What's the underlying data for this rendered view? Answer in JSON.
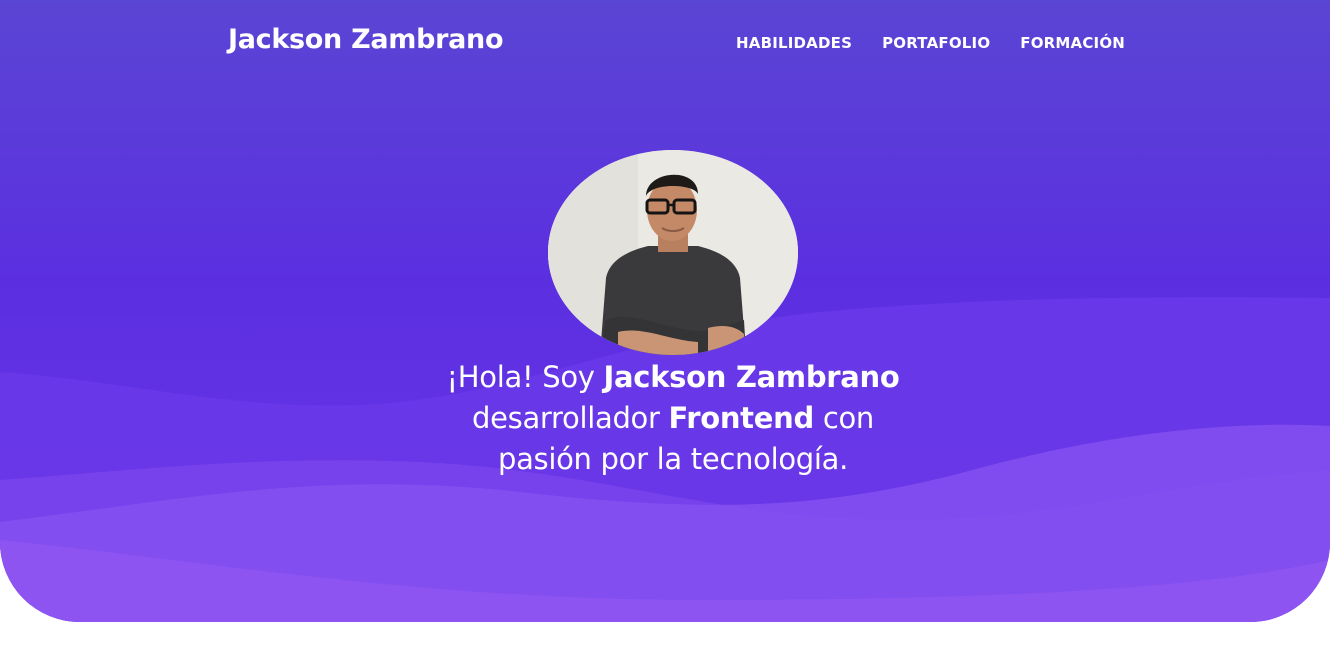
{
  "header": {
    "brand": "Jackson Zambrano",
    "nav": [
      {
        "label": "HABILIDADES"
      },
      {
        "label": "PORTAFOLIO"
      },
      {
        "label": "FORMACIÓN"
      }
    ]
  },
  "hero": {
    "greeting": "¡Hola! Soy ",
    "name": "Jackson Zambrano",
    "role_prefix": "desarrollador ",
    "role": "Frontend",
    "role_suffix": " con",
    "tagline": "pasión por la tecnología.",
    "avatar_icon": "profile-photo"
  },
  "colors": {
    "hero_top": "#5b45d4",
    "hero_mid": "#5b2fe0",
    "wave_light": "#8b5cf0",
    "text": "#ffffff"
  }
}
